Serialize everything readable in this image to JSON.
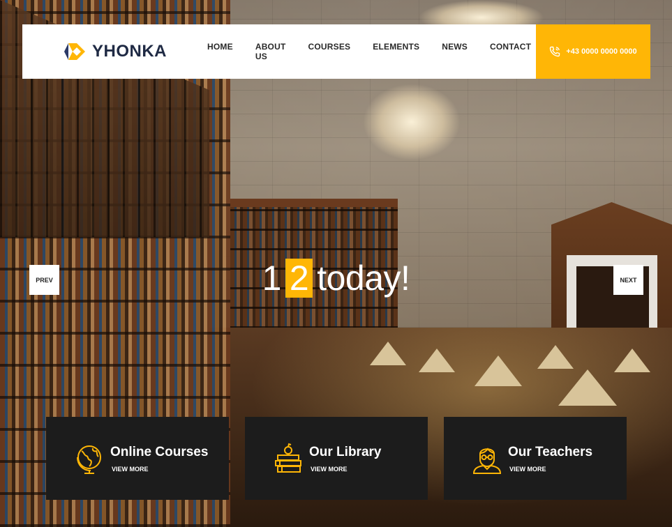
{
  "brand": {
    "name": "YHONKA"
  },
  "nav": {
    "items": [
      {
        "label": "HOME"
      },
      {
        "label": "ABOUT US"
      },
      {
        "label": "COURSES"
      },
      {
        "label": "ELEMENTS"
      },
      {
        "label": "NEWS"
      },
      {
        "label": "CONTACT"
      }
    ]
  },
  "contact": {
    "phone": "+43 0000 0000 0000",
    "icon": "phone-icon"
  },
  "slider": {
    "headline_before": "1",
    "headline_highlight": "2",
    "headline_after": "today!",
    "prev_label": "PREV",
    "next_label": "NEXT"
  },
  "features": [
    {
      "title": "Online Courses",
      "link": "VIEW MORE",
      "icon": "globe-icon"
    },
    {
      "title": "Our Library",
      "link": "VIEW MORE",
      "icon": "books-icon"
    },
    {
      "title": "Our Teachers",
      "link": "VIEW MORE",
      "icon": "teacher-icon"
    }
  ],
  "colors": {
    "accent": "#ffb606",
    "dark": "#1c1c1c",
    "brand_text": "#1f2a44"
  }
}
